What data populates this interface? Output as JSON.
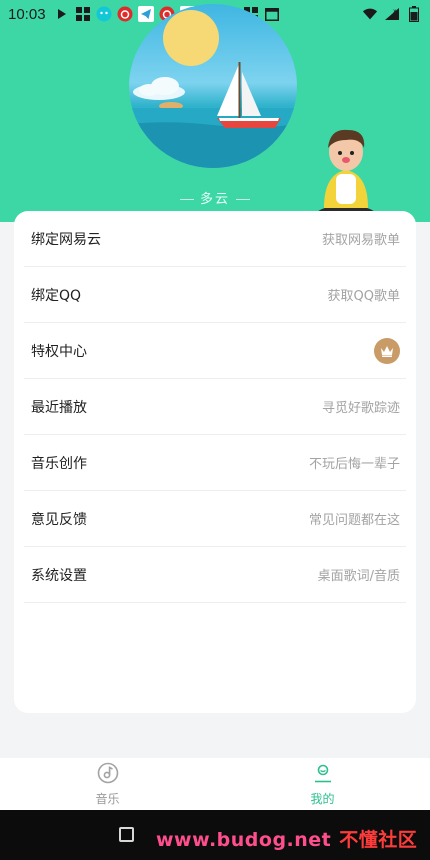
{
  "status_bar": {
    "time": "10:03",
    "icons": [
      "play-icon",
      "app-icon",
      "cat-icon",
      "netease-icon",
      "telegram-icon",
      "netease-icon",
      "telegram-icon",
      "download-icon",
      "image-icon",
      "app-icon",
      "calendar-icon"
    ],
    "right_icons": [
      "wifi-icon",
      "signal-icon",
      "battery-icon"
    ]
  },
  "header": {
    "background_color": "#3dd7a6",
    "weather_text": "多云"
  },
  "menu": {
    "items": [
      {
        "label": "绑定网易云",
        "hint": "获取网易歌单"
      },
      {
        "label": "绑定QQ",
        "hint": "获取QQ歌单"
      },
      {
        "label": "特权中心",
        "hint": "",
        "icon": "crown-icon"
      },
      {
        "label": "最近播放",
        "hint": "寻觅好歌踪迹"
      },
      {
        "label": "音乐创作",
        "hint": "不玩后悔一辈子"
      },
      {
        "label": "意见反馈",
        "hint": "常见问题都在这"
      },
      {
        "label": "系统设置",
        "hint": "桌面歌词/音质"
      }
    ]
  },
  "tabbar": {
    "tabs": [
      {
        "label": "音乐",
        "icon": "music-disc-icon",
        "active": false
      },
      {
        "label": "我的",
        "icon": "user-icon",
        "active": true
      }
    ],
    "active_color": "#2dbf8c"
  },
  "watermark": {
    "url": "www.budog.net",
    "name": "不懂社区"
  }
}
